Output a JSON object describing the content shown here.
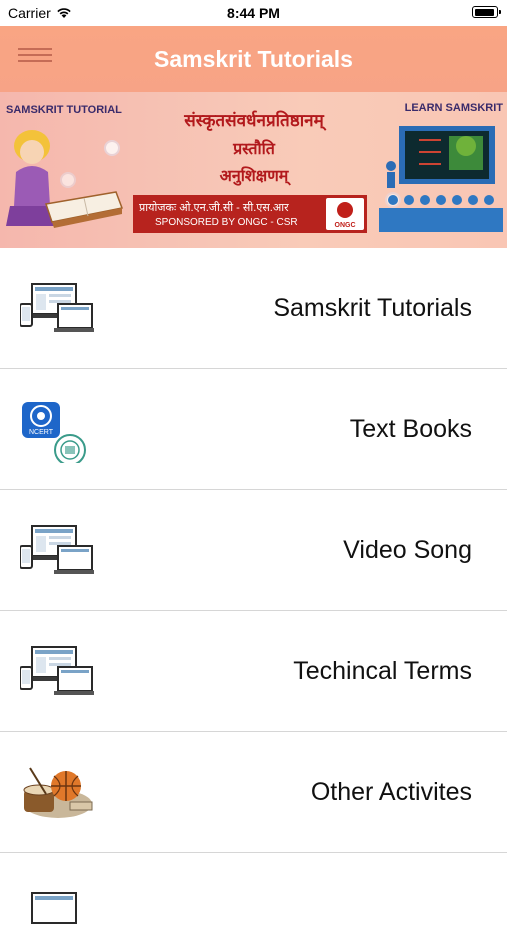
{
  "status_bar": {
    "carrier": "Carrier",
    "time": "8:44 PM"
  },
  "header": {
    "title": "Samskrit Tutorials",
    "menu_icon": "hamburger-menu-icon",
    "background_color": "#f9a583"
  },
  "banner": {
    "left_label": "SAMSKRIT TUTORIAL",
    "right_label": "LEARN SAMSKRIT",
    "heading_line1": "संस्कृतसंवर्धनप्रतिष्ठानम्",
    "heading_line2": "प्रस्तौति",
    "heading_line3": "अनुशिक्षणम्",
    "sponsor_hindi": "प्रायोजकः ओ.एन.जी.सी - सी.एस.आर",
    "sponsor_english": "SPONSORED BY ONGC - CSR",
    "logo_text": "ONGC"
  },
  "menu_items": [
    {
      "label": "Samskrit Tutorials",
      "icon": "devices-icon"
    },
    {
      "label": "Text Books",
      "icon": "ncert-books-icon"
    },
    {
      "label": "Video Song",
      "icon": "devices-icon"
    },
    {
      "label": "Techincal Terms",
      "icon": "devices-icon"
    },
    {
      "label": "Other Activites",
      "icon": "sports-activities-icon"
    }
  ]
}
